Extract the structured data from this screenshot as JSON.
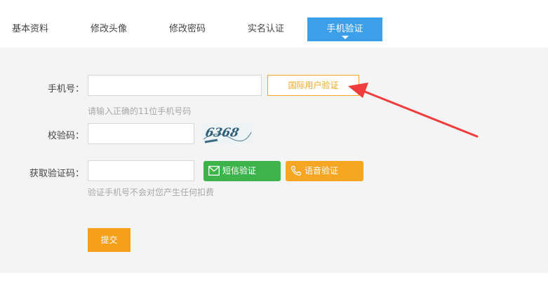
{
  "tabs": [
    {
      "label": "基本资料"
    },
    {
      "label": "修改头像"
    },
    {
      "label": "修改密码"
    },
    {
      "label": "实名认证"
    },
    {
      "label": "手机验证"
    }
  ],
  "form": {
    "phone_label": "手机号：",
    "phone_value": "",
    "phone_hint": "请输入正确的11位手机号码",
    "intl_button": "国际用户验证",
    "check_label": "校验码：",
    "check_value": "",
    "captcha_text": "6368",
    "code_label": "获取验证码：",
    "code_value": "",
    "sms_button": "短信验证",
    "voice_button": "语音验证",
    "code_hint": "验证手机号不会对您产生任何扣费",
    "submit_button": "提交"
  },
  "colors": {
    "active_tab": "#3d9ee9",
    "orange": "#f5a623",
    "green": "#3cb44b",
    "annotation_arrow": "#f03c3c"
  },
  "icons": {
    "sms": "envelope-icon",
    "voice": "phone-icon",
    "annotation": "red-arrow"
  }
}
